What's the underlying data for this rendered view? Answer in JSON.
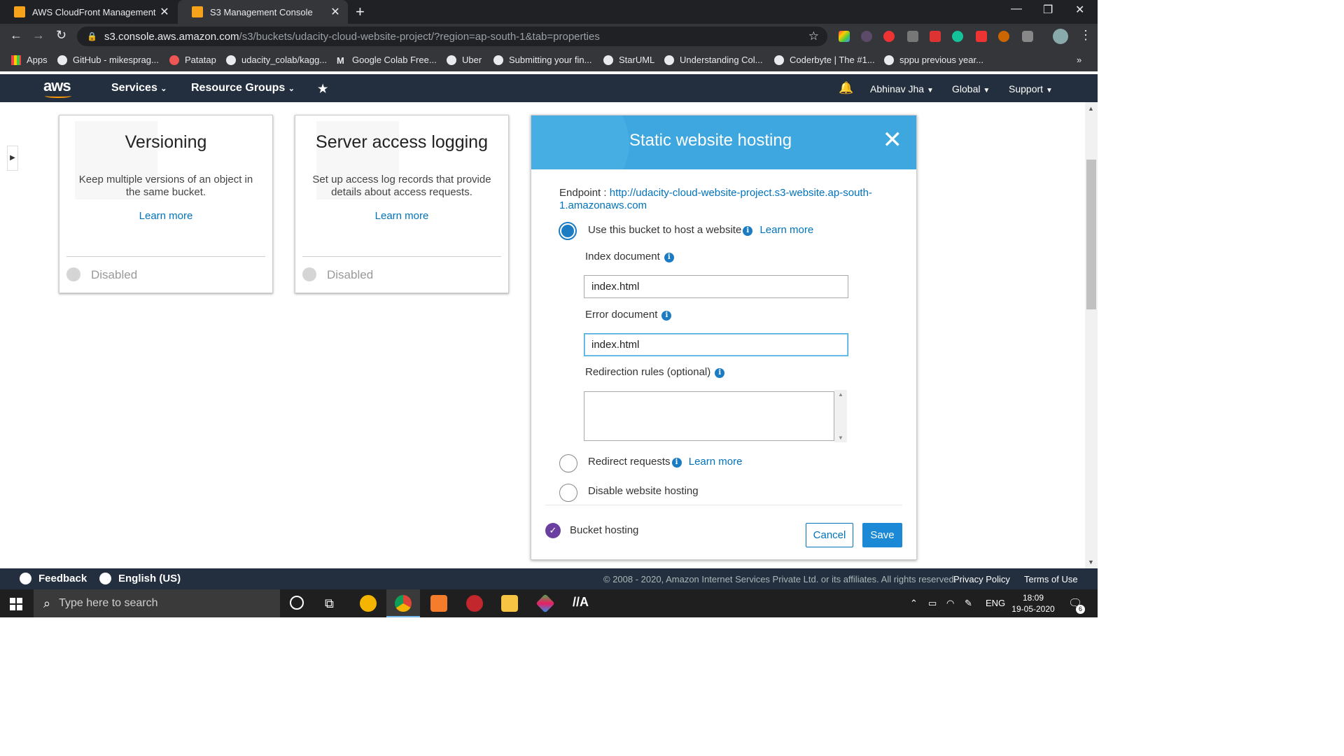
{
  "browser": {
    "tabs": [
      {
        "title": "AWS CloudFront Management C",
        "active": false
      },
      {
        "title": "S3 Management Console",
        "active": true
      }
    ],
    "url_host": "s3.console.aws.amazon.com",
    "url_path": "/s3/buckets/udacity-cloud-website-project/?region=ap-south-1&tab=properties",
    "bookmarks": [
      "Apps",
      "GitHub - mikesprag...",
      "Patatap",
      "udacity_colab/kagg...",
      "Google Colab Free...",
      "Uber",
      "Submitting your fin...",
      "StarUML",
      "Understanding Col...",
      "Coderbyte | The #1...",
      "sppu previous year..."
    ],
    "ext_badge": "desc"
  },
  "aws_nav": {
    "logo": "aws",
    "services": "Services",
    "resource_groups": "Resource Groups",
    "user": "Abhinav Jha",
    "region": "Global",
    "support": "Support"
  },
  "cards": [
    {
      "title": "Versioning",
      "description": "Keep multiple versions of an object in the same bucket.",
      "link": "Learn more",
      "status": "Disabled"
    },
    {
      "title": "Server access logging",
      "description": "Set up access log records that provide details about access requests.",
      "link": "Learn more",
      "status": "Disabled"
    }
  ],
  "modal": {
    "title": "Static website hosting",
    "endpoint_label": "Endpoint :",
    "endpoint_url": "http://udacity-cloud-website-project.s3-website.ap-south-1.amazonaws.com",
    "options": {
      "use_bucket": "Use this bucket to host a website",
      "redirect": "Redirect requests",
      "disable": "Disable website hosting"
    },
    "learn_more": "Learn more",
    "index_label": "Index document",
    "index_value": "index.html",
    "error_label": "Error document",
    "error_value": "index.html",
    "redirection_label": "Redirection rules (optional)",
    "redirection_value": "",
    "bucket_hosting": "Bucket hosting",
    "cancel": "Cancel",
    "save": "Save"
  },
  "footer": {
    "feedback": "Feedback",
    "language": "English (US)",
    "copyright": "© 2008 - 2020, Amazon Internet Services Private Ltd. or its affiliates. All rights reserved.",
    "privacy": "Privacy Policy",
    "terms": "Terms of Use"
  },
  "taskbar": {
    "search_placeholder": "Type here to search",
    "lang": "ENG",
    "time": "18:09",
    "date": "19-05-2020",
    "notif_count": "6"
  },
  "colors": {
    "aws_nav": "#232f3e",
    "modal_header": "#3ea7df",
    "link": "#0073bb",
    "primary_button": "#1c89d6"
  }
}
